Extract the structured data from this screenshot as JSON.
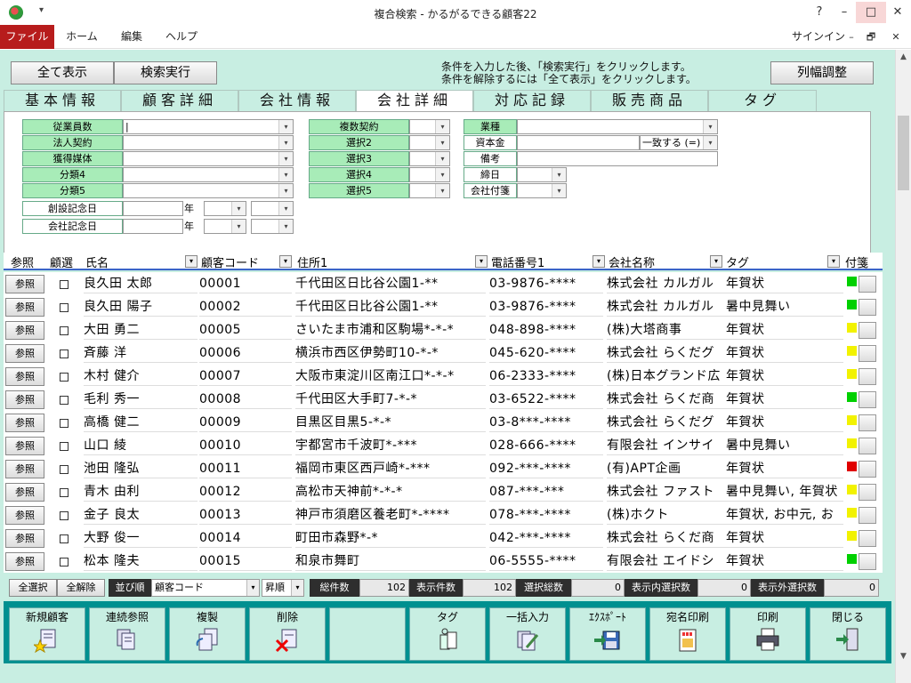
{
  "window": {
    "title": "複合検索 - かるがるできる顧客22",
    "help": "?",
    "minimize": "–",
    "maximize": "□",
    "close": "✕"
  },
  "ribbon": {
    "file": "ファイル",
    "home": "ホーム",
    "edit": "編集",
    "help": "ヘルプ",
    "signin": "サインイン",
    "minimize": "–",
    "restore": "🗗",
    "close": "✕"
  },
  "top": {
    "show_all": "全て表示",
    "search": "検索実行",
    "hint1": "条件を入力した後、「検索実行」をクリックします。",
    "hint2": "条件を解除するには「全て表示」をクリックします。",
    "adjust": "列幅調整"
  },
  "tabs": [
    "基本情報",
    "顧客詳細",
    "会社情報",
    "会社詳細",
    "対応記録",
    "販売商品",
    "タグ"
  ],
  "filters": {
    "col1": [
      "従業員数",
      "法人契約",
      "獲得媒体",
      "分類4",
      "分類5",
      "創設記念日",
      "会社記念日"
    ],
    "year": "年",
    "col2": [
      "複数契約",
      "選択2",
      "選択3",
      "選択4",
      "選択5"
    ],
    "col3": [
      "業種",
      "資本金",
      "備考",
      "締日",
      "会社付箋"
    ],
    "match": "一致する (=)"
  },
  "grid": {
    "headers": {
      "ref": "参照",
      "sel": "顧選",
      "name": "氏名",
      "code": "顧客コード",
      "addr": "住所1",
      "tel": "電話番号1",
      "company": "会社名称",
      "tag": "タグ",
      "note": "付箋"
    },
    "ref_label": "参照",
    "rows": [
      {
        "name": "良久田 太郎",
        "code": "00001",
        "addr": "千代田区日比谷公園1-**",
        "tel": "03-9876-****",
        "company": "株式会社 カルガル",
        "tag": "年賀状",
        "color": "#00d000"
      },
      {
        "name": "良久田 陽子",
        "code": "00002",
        "addr": "千代田区日比谷公園1-**",
        "tel": "03-9876-****",
        "company": "株式会社 カルガル",
        "tag": "暑中見舞い",
        "color": "#00d000"
      },
      {
        "name": "大田 勇二",
        "code": "00005",
        "addr": "さいたま市浦和区駒場*-*-*",
        "tel": "048-898-****",
        "company": "(株)大塔商事",
        "tag": "年賀状",
        "color": "#f2f200"
      },
      {
        "name": "斉藤 洋",
        "code": "00006",
        "addr": "横浜市西区伊勢町10-*-*",
        "tel": "045-620-****",
        "company": "株式会社 らくだグ",
        "tag": "年賀状",
        "color": "#f2f200"
      },
      {
        "name": "木村 健介",
        "code": "00007",
        "addr": "大阪市東淀川区南江口*-*-*",
        "tel": "06-2333-****",
        "company": "(株)日本グランド広",
        "tag": "年賀状",
        "color": "#f2f200"
      },
      {
        "name": "毛利 秀一",
        "code": "00008",
        "addr": "千代田区大手町7-*-*",
        "tel": "03-6522-****",
        "company": "株式会社 らくだ商",
        "tag": "年賀状",
        "color": "#00d000"
      },
      {
        "name": "高橋 健二",
        "code": "00009",
        "addr": "目黒区目黒5-*-*",
        "tel": "03-8***-****",
        "company": "株式会社 らくだグ",
        "tag": "年賀状",
        "color": "#f2f200"
      },
      {
        "name": "山口 綾",
        "code": "00010",
        "addr": "宇都宮市千波町*-***",
        "tel": "028-666-****",
        "company": "有限会社 インサイ",
        "tag": "暑中見舞い",
        "color": "#f2f200"
      },
      {
        "name": "池田 隆弘",
        "code": "00011",
        "addr": "福岡市東区西戸崎*-***",
        "tel": "092-***-****",
        "company": "(有)APT企画",
        "tag": "年賀状",
        "color": "#e00000"
      },
      {
        "name": "青木 由利",
        "code": "00012",
        "addr": "高松市天神前*-*-*",
        "tel": "087-***-***",
        "company": "株式会社 ファスト",
        "tag": "暑中見舞い, 年賀状",
        "color": "#f2f200"
      },
      {
        "name": "金子 良太",
        "code": "00013",
        "addr": "神戸市須磨区養老町*-****",
        "tel": "078-***-****",
        "company": "(株)ホクト",
        "tag": "年賀状, お中元, お",
        "color": "#f2f200"
      },
      {
        "name": "大野 俊一",
        "code": "00014",
        "addr": "町田市森野*-*",
        "tel": "042-***-****",
        "company": "株式会社 らくだ商",
        "tag": "年賀状",
        "color": "#f2f200"
      },
      {
        "name": "松本 隆夫",
        "code": "00015",
        "addr": "和泉市舞町",
        "tel": "06-5555-****",
        "company": "有限会社 エイドシ",
        "tag": "年賀状",
        "color": "#00d000"
      }
    ]
  },
  "status": {
    "select_all": "全選択",
    "deselect_all": "全解除",
    "sort_label": "並び順",
    "sort_field": "顧客コード",
    "sort_order": "昇順",
    "total_label": "総件数",
    "total": "102",
    "shown_label": "表示件数",
    "shown": "102",
    "selected_label": "選択総数",
    "selected": "0",
    "in_label": "表示内選択数",
    "in": "0",
    "out_label": "表示外選択数",
    "out": "0"
  },
  "toolbar": [
    "新規顧客",
    "連続参照",
    "複製",
    "削除",
    "",
    "タグ",
    "一括入力",
    "ｴｸｽﾎﾟｰﾄ",
    "宛名印刷",
    "印刷",
    "閉じる"
  ]
}
